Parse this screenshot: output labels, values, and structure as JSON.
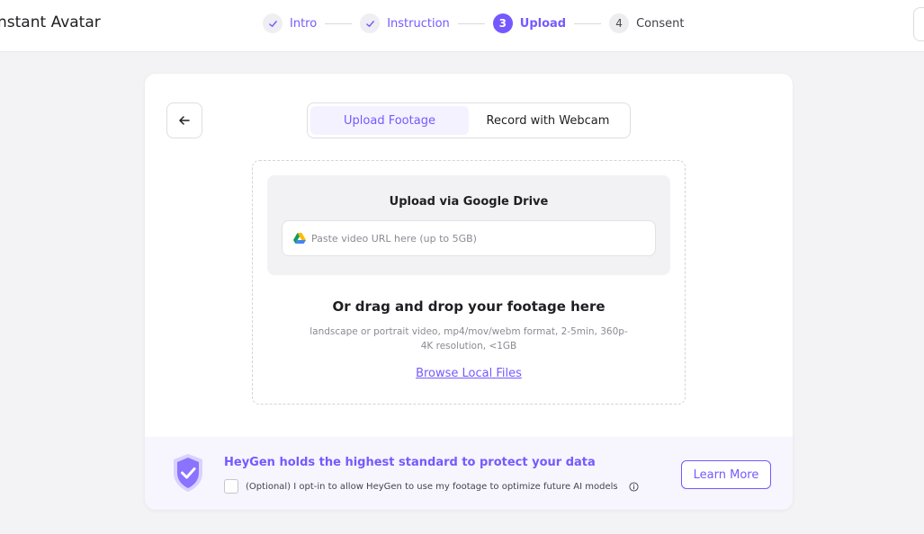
{
  "app": {
    "title": "Instant Avatar"
  },
  "stepper": {
    "steps": [
      {
        "number": "",
        "label": "Intro",
        "state": "done"
      },
      {
        "number": "",
        "label": "Instruction",
        "state": "done"
      },
      {
        "number": "3",
        "label": "Upload",
        "state": "active"
      },
      {
        "number": "4",
        "label": "Consent",
        "state": "todo"
      }
    ]
  },
  "tabs": [
    {
      "label": "Upload Footage",
      "active": true
    },
    {
      "label": "Record with Webcam",
      "active": false
    }
  ],
  "drive": {
    "title": "Upload via Google Drive",
    "placeholder": "Paste video URL here (up to 5GB)",
    "value": ""
  },
  "dropzone": {
    "title": "Or drag and drop your footage here",
    "hint": "landscape or portrait video, mp4/mov/webm format, 2-5min, 360p-4K resolution, <1GB",
    "browse_label": "Browse Local Files"
  },
  "privacy": {
    "title": "HeyGen holds the highest standard to protect your data",
    "optin_label": "(Optional) I opt-in to allow HeyGen to use my footage to optimize future AI models",
    "optin_checked": false,
    "learn_more_label": "Learn More"
  },
  "icons": {
    "back": "arrow-left-icon",
    "drive": "google-drive-icon",
    "shield": "shield-check-icon",
    "info": "info-icon",
    "check": "check-icon"
  },
  "colors": {
    "accent": "#7559ff",
    "background": "#f3f3f5",
    "footer_bg": "#f7f5fe"
  }
}
